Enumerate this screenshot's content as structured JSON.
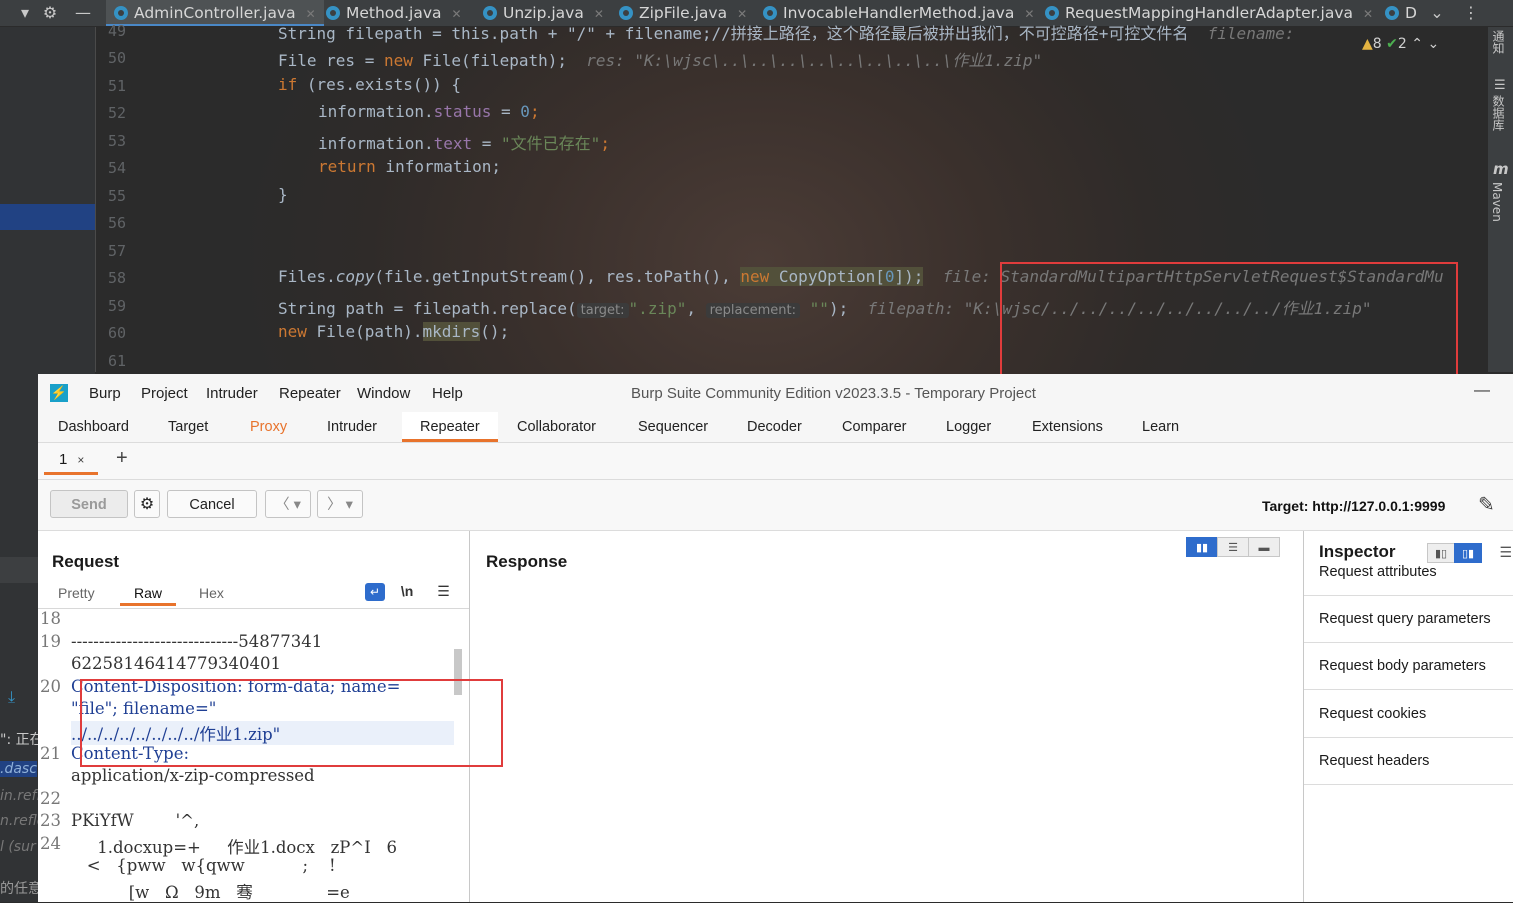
{
  "ide": {
    "toolbar_icons": [
      "gear-icon",
      "minus-icon"
    ],
    "file_tabs": [
      {
        "name": "AdminController.java",
        "active": true
      },
      {
        "name": "Method.java",
        "active": false
      },
      {
        "name": "Unzip.java",
        "active": false
      },
      {
        "name": "ZipFile.java",
        "active": false
      },
      {
        "name": "InvocableHandlerMethod.java",
        "active": false
      },
      {
        "name": "RequestMappingHandlerAdapter.java",
        "active": false
      },
      {
        "name": "D",
        "active": false
      }
    ],
    "right_panel": {
      "warnings": "8",
      "checks": "2",
      "notifications_label": "通知",
      "database_label": "数据库",
      "maven_label": "Maven"
    },
    "left_fragments": [
      "\": 正在",
      ".dasc",
      "in.refl",
      "n.refle",
      "l (sur",
      "的任意"
    ],
    "line_numbers": [
      "49",
      "50",
      "51",
      "52",
      "53",
      "54",
      "55",
      "56",
      "57",
      "58",
      "59",
      "60",
      "61"
    ],
    "code": {
      "l49": "String filepath = this.path + \"/\" + filename;//拼接上路径，这个路径最后被拼出我们，不可控路径+可控文件名",
      "l49_hint": "filename:",
      "l50_a": "File res = ",
      "l50_b": "new",
      "l50_c": " File(filepath);",
      "l50_hint": "res: \"K:\\wjsc\\..\\..\\..\\..\\..\\..\\..\\..\\作业1.zip\"",
      "l51_a": "if",
      "l51_b": " (res.exists()) {",
      "l52_a": "information.",
      "l52_b": "status",
      "l52_c": " = ",
      "l52_d": "0",
      "l52_e": ";",
      "l53_a": "information.",
      "l53_b": "text",
      "l53_c": " = ",
      "l53_d": "\"文件已存在\"",
      "l53_e": ";",
      "l54_a": "return",
      "l54_b": " information;",
      "l55": "}",
      "l58_a": "Files.",
      "l58_b": "copy",
      "l58_c": "(file.getInputStream(), res.toPath(), ",
      "l58_d": "new",
      "l58_e": " CopyOption[",
      "l58_f": "0",
      "l58_g": "]);",
      "l58_hint": "file: StandardMultipartHttpServletRequest$StandardMu",
      "l59_a": "String path = filepath.replace(",
      "l59_p1": "target:",
      "l59_s1": "\".zip\"",
      "l59_c": ", ",
      "l59_p2": "replacement:",
      "l59_s2": "\"\"",
      "l59_d": ");",
      "l59_hint": "filepath: \"K:\\wjsc/../../../../../../../../作业1.zip\"",
      "l60_a": "new",
      "l60_b": " File(path).",
      "l60_c": "mkdirs",
      "l60_d": "();"
    }
  },
  "burp": {
    "menu": [
      "Burp",
      "Project",
      "Intruder",
      "Repeater",
      "Window",
      "Help"
    ],
    "app_title": "Burp Suite Community Edition v2023.3.5 - Temporary Project",
    "tabs": [
      "Dashboard",
      "Target",
      "Proxy",
      "Intruder",
      "Repeater",
      "Collaborator",
      "Sequencer",
      "Decoder",
      "Comparer",
      "Logger",
      "Extensions",
      "Learn"
    ],
    "active_tab": "Repeater",
    "repeater_tab": {
      "label": "1",
      "close": "×",
      "add": "+"
    },
    "toolbar": {
      "send": "Send",
      "cancel": "Cancel",
      "target": "Target: http://127.0.0.1:9999"
    },
    "request": {
      "title": "Request",
      "view_tabs": [
        "Pretty",
        "Raw",
        "Hex"
      ],
      "active_view": "Raw",
      "newline_label": "\\n",
      "lines": [
        {
          "n": "18",
          "text": ""
        },
        {
          "n": "19",
          "text": "------------------------------54877341"
        },
        {
          "n": "",
          "text": "6225814641477934040​1"
        },
        {
          "n": "20",
          "text": "Content-Disposition: form-data; name="
        },
        {
          "n": "",
          "text": "\"file\"; filename=\""
        },
        {
          "n": "",
          "text": "../../../../../../../../作业1.zip\""
        },
        {
          "n": "21",
          "text": "Content-Type:"
        },
        {
          "n": "",
          "text": "application/x-zip-compressed"
        },
        {
          "n": "22",
          "text": ""
        },
        {
          "n": "23",
          "text": "PKiYfW        '^,"
        },
        {
          "n": "24",
          "text": "     1.docxup=+     作业1.docx   zP^I   6"
        },
        {
          "n": "",
          "text": "   <   {pww   w{qww           ;    !"
        },
        {
          "n": "",
          "text": "           [w   Ω   9m   骞              =e"
        }
      ]
    },
    "response": {
      "title": "Response"
    },
    "inspector": {
      "title": "Inspector",
      "items": [
        "Request attributes",
        "Request query parameters",
        "Request body parameters",
        "Request cookies",
        "Request headers"
      ]
    }
  }
}
